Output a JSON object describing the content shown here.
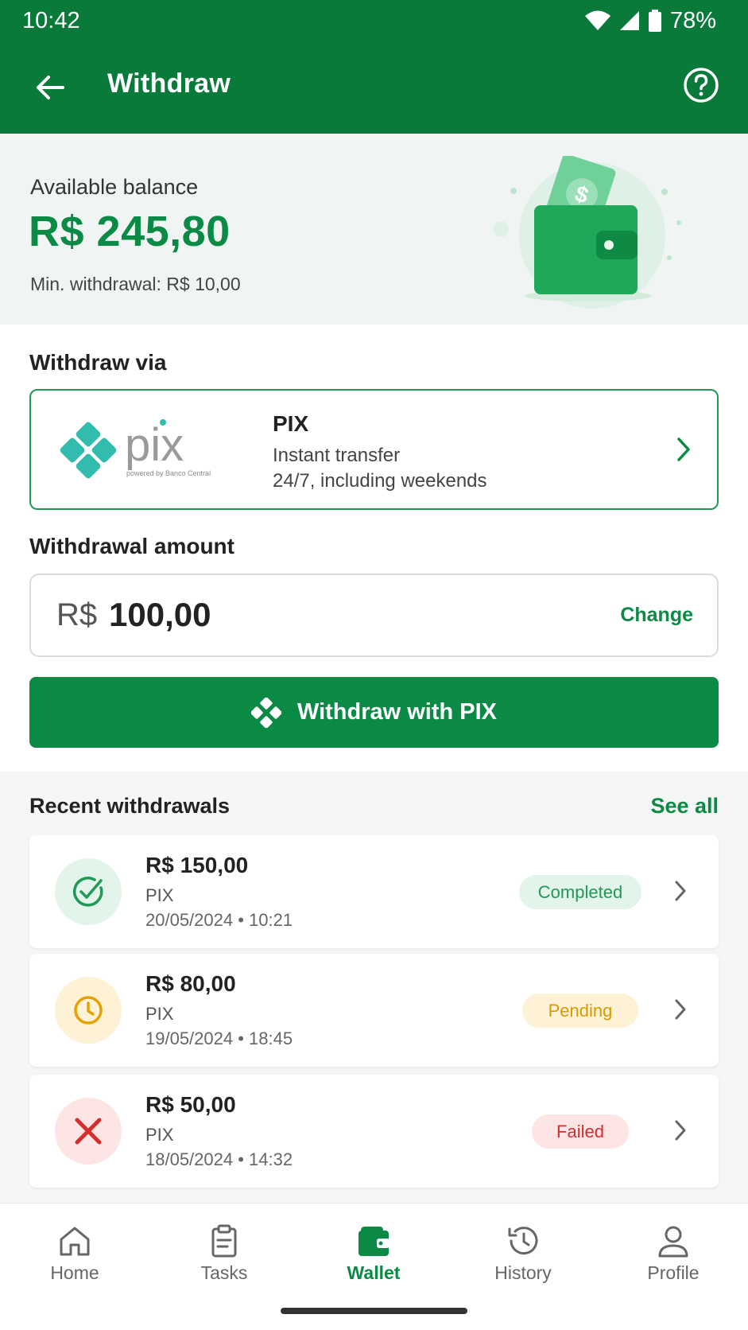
{
  "status_bar": {
    "time": "10:42",
    "battery": "78%"
  },
  "app_bar": {
    "title": "Withdraw"
  },
  "balance": {
    "label": "Available balance",
    "value": "R$ 245,80",
    "min_withdrawal": "Min. withdrawal: R$ 10,00"
  },
  "withdraw_via": {
    "title": "Withdraw via",
    "method_name": "PIX",
    "description_line1": "Instant transfer",
    "description_line2": "24/7, including weekends",
    "logo_text": "pix",
    "logo_subtext": "powered by Banco Central"
  },
  "amount": {
    "title": "Withdrawal amount",
    "currency": "R$",
    "value": "100,00",
    "change_label": "Change"
  },
  "primary_button": {
    "label": "Withdraw with PIX"
  },
  "recent": {
    "title": "Recent withdrawals",
    "see_all": "See all",
    "items": [
      {
        "amount": "R$ 150,00",
        "method": "PIX",
        "date": "20/05/2024 • 10:21",
        "status": "Completed"
      },
      {
        "amount": "R$ 80,00",
        "method": "PIX",
        "date": "19/05/2024 • 18:45",
        "status": "Pending"
      },
      {
        "amount": "R$ 50,00",
        "method": "PIX",
        "date": "18/05/2024 • 14:32",
        "status": "Failed"
      }
    ]
  },
  "bottom_nav": {
    "items": [
      {
        "label": "Home",
        "icon": "home-icon"
      },
      {
        "label": "Tasks",
        "icon": "clipboard-icon"
      },
      {
        "label": "Wallet",
        "icon": "wallet-icon",
        "active": true
      },
      {
        "label": "History",
        "icon": "history-icon"
      },
      {
        "label": "Profile",
        "icon": "person-icon"
      }
    ]
  },
  "colors": {
    "brand_green": "#0a7a3b",
    "accent_green": "#0a8a44",
    "pending": "#e6a100",
    "failed": "#d32f2f",
    "pix_teal": "#32bcad"
  }
}
